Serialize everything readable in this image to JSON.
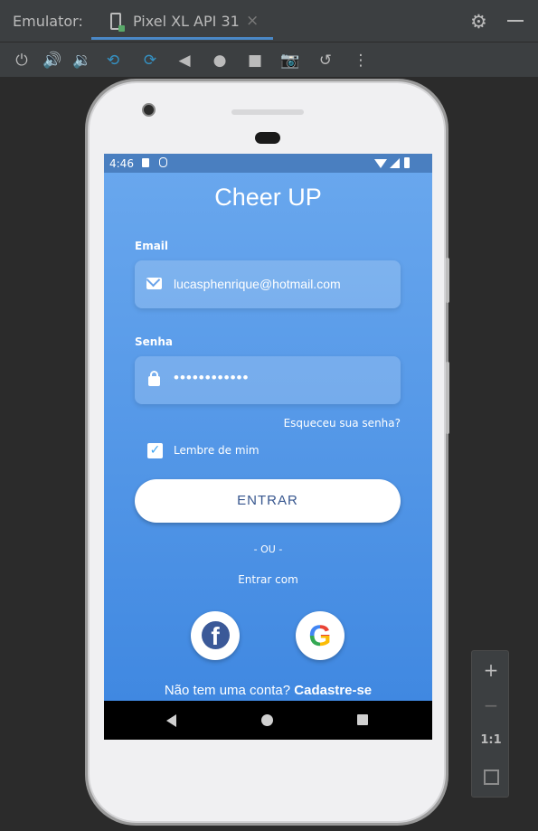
{
  "window": {
    "label": "Emulator:",
    "tab_title": "Pixel XL API 31",
    "tab_close": "×"
  },
  "toolbar": {
    "icons": [
      "power-icon",
      "volume-up-icon",
      "volume-down-icon",
      "rotate-left-icon",
      "rotate-right-icon",
      "back-icon",
      "home-icon",
      "overview-icon",
      "screenshot-icon",
      "snapshot-icon",
      "more-icon"
    ]
  },
  "side_panel": {
    "zoom_in": "+",
    "zoom_out": "−",
    "actual_size": "1:1"
  },
  "device": {
    "status_bar": {
      "time": "4:46"
    },
    "app": {
      "title": "Cheer UP",
      "email_label": "Email",
      "email_value": "lucasphenrique@hotmail.com",
      "password_label": "Senha",
      "password_value": "••••••••••••",
      "forgot_password": "Esqueceu sua senha?",
      "remember_me": "Lembre de mim",
      "remember_checked": true,
      "enter_button": "ENTRAR",
      "or_divider": "- OU -",
      "enter_with": "Entrar com",
      "facebook_glyph": "f",
      "google_glyph": "G",
      "signup_prefix": "Não tem uma conta? ",
      "signup_link": "Cadastre-se"
    }
  },
  "colors": {
    "accent": "#4a88c7",
    "gradient_top": "#6aa8ee",
    "gradient_bottom": "#3d86e0",
    "button_text": "#37568e",
    "facebook": "#3b5998"
  }
}
